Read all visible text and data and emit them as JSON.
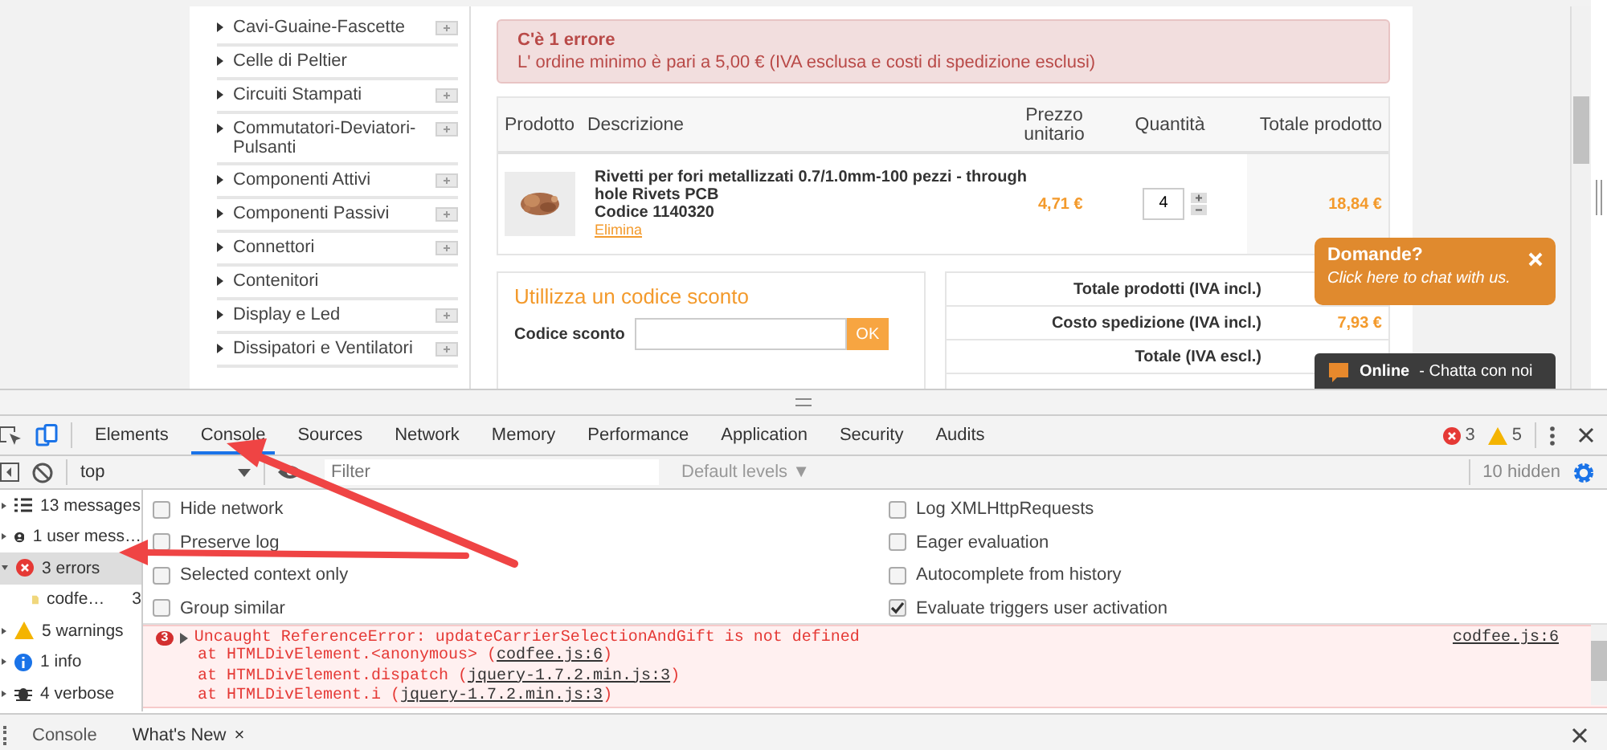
{
  "page": {
    "categories": [
      {
        "label": "Cavi-Guaine-Fascette",
        "expandable": true
      },
      {
        "label": "Celle di Peltier",
        "expandable": false
      },
      {
        "label": "Circuiti Stampati",
        "expandable": true
      },
      {
        "label": "Commutatori-Deviatori-Pulsanti",
        "expandable": true
      },
      {
        "label": "Componenti Attivi",
        "expandable": true
      },
      {
        "label": "Componenti Passivi",
        "expandable": true
      },
      {
        "label": "Connettori",
        "expandable": true
      },
      {
        "label": "Contenitori",
        "expandable": false
      },
      {
        "label": "Display e Led",
        "expandable": true
      },
      {
        "label": "Dissipatori e Ventilatori",
        "expandable": true
      }
    ],
    "error": {
      "title": "C'è 1 errore",
      "message": "L' ordine minimo è pari a 5,00 € (IVA esclusa e costi di spedizione esclusi)"
    },
    "cart": {
      "columns": [
        "Prodotto",
        "Descrizione",
        "Prezzo unitario",
        "Quantità",
        "Totale prodotto"
      ],
      "rows": [
        {
          "name": "Rivetti per fori metallizzati 0.7/1.0mm-100 pezzi - through hole Rivets PCB",
          "code": "Codice 1140320",
          "remove": "Elimina",
          "price": "4,71 €",
          "quantity": "4",
          "total": "18,84 €"
        }
      ]
    },
    "discount": {
      "title": "Utillizza un codice sconto",
      "label": "Codice sconto",
      "button": "OK"
    },
    "totals": [
      {
        "label": "Totale prodotti (IVA incl.)"
      },
      {
        "label": "Costo spedizione (IVA incl.)",
        "value": "7,93 €"
      },
      {
        "label": "Totale (IVA escl.)"
      }
    ],
    "chat": {
      "title": "Domande?",
      "subtitle": "Click here to chat with us.",
      "status": "Online",
      "status_text": "- Chatta con noi"
    }
  },
  "devtools": {
    "tabs": [
      {
        "label": "Elements",
        "selected": false
      },
      {
        "label": "Console",
        "selected": true
      },
      {
        "label": "Sources",
        "selected": false
      },
      {
        "label": "Network",
        "selected": false
      },
      {
        "label": "Memory",
        "selected": false
      },
      {
        "label": "Performance",
        "selected": false
      },
      {
        "label": "Application",
        "selected": false
      },
      {
        "label": "Security",
        "selected": false
      },
      {
        "label": "Audits",
        "selected": false
      }
    ],
    "error_count": "3",
    "warning_count": "5",
    "context": "top",
    "filter_placeholder": "Filter",
    "levels": "Default levels ▼",
    "hidden": "10 hidden",
    "sidebar": [
      {
        "kind": "list",
        "label": "13 messages",
        "selected": false,
        "expanded": false
      },
      {
        "kind": "user",
        "label": "1 user mess…",
        "selected": false,
        "expanded": false
      },
      {
        "kind": "error",
        "label": "3 errors",
        "selected": true,
        "expanded": true,
        "children": [
          {
            "label": "codfe…",
            "count": "3"
          }
        ]
      },
      {
        "kind": "warning",
        "label": "5 warnings",
        "selected": false,
        "expanded": false
      },
      {
        "kind": "info",
        "label": "1 info",
        "selected": false,
        "expanded": false
      },
      {
        "kind": "verbose",
        "label": "4 verbose",
        "selected": false,
        "expanded": false
      }
    ],
    "settings": [
      {
        "label": "Hide network",
        "checked": false
      },
      {
        "label": "Log XMLHttpRequests",
        "checked": false
      },
      {
        "label": "Preserve log",
        "checked": false
      },
      {
        "label": "Eager evaluation",
        "checked": false
      },
      {
        "label": "Selected context only",
        "checked": false
      },
      {
        "label": "Autocomplete from history",
        "checked": false
      },
      {
        "label": "Group similar",
        "checked": false
      },
      {
        "label": "Evaluate triggers user activation",
        "checked": true
      }
    ],
    "messages": [
      {
        "count": "3",
        "text": "Uncaught ReferenceError: updateCarrierSelectionAndGift is not defined",
        "source": "codfee.js:6",
        "stack": [
          {
            "text": "at HTMLDivElement.<anonymous> (",
            "link": "codfee.js:6",
            "end": ")"
          },
          {
            "text": "at HTMLDivElement.dispatch (",
            "link": "jquery-1.7.2.min.js:3",
            "end": ")"
          },
          {
            "text": "at HTMLDivElement.i (",
            "link": "jquery-1.7.2.min.js:3",
            "end": ")"
          }
        ]
      }
    ],
    "drawer_tabs": [
      {
        "label": "Console",
        "selected": false
      },
      {
        "label": "What's New",
        "selected": true,
        "close": "×"
      }
    ]
  }
}
